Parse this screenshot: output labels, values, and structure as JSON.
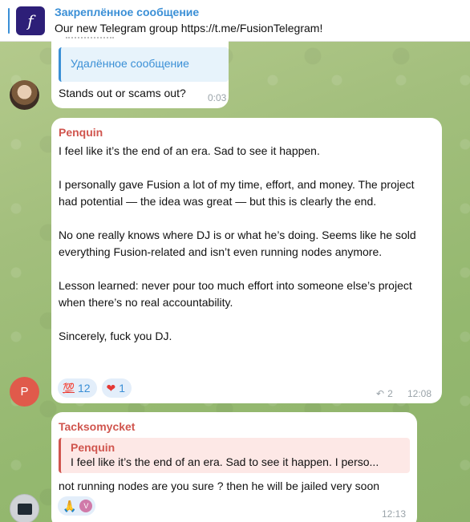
{
  "pinned": {
    "title": "Закреплённое сообщение",
    "text": "Our new Telegram group  https://t.me/FusionTelegram!"
  },
  "message1": {
    "reply_text": "Удалённое сообщение",
    "text": "Stands out or scams out?",
    "time": "0:03"
  },
  "message2": {
    "sender": "Penquin",
    "avatar_letter": "P",
    "paragraphs": [
      "I feel like it’s the end of an era. Sad to see it happen.",
      "I personally gave Fusion a lot of my time, effort, and money. The project had potential — the idea was great — but this is clearly the end.",
      "No one really knows where DJ is or what he’s doing. Seems like he sold everything Fusion-related and isn’t even running nodes anymore.",
      "Lesson learned: never pour too much effort into someone else’s project when there’s no real accountability.",
      "Sincerely, fuck you DJ."
    ],
    "reactions": [
      {
        "emoji": "💯",
        "count": "12"
      },
      {
        "emoji": "❤",
        "count": "1"
      }
    ],
    "replies": "2",
    "time": "12:08"
  },
  "message3": {
    "sender": "Tacksomycket",
    "reply_sender": "Penquin",
    "reply_text": "I feel like it’s the end of an era. Sad to see it happen.  I perso...",
    "text": "not running nodes are you sure ? then he will be jailed very soon",
    "reaction_emoji": "🙏",
    "reaction_user": "V",
    "time": "12:13"
  },
  "colors": {
    "accent": "#3a8fd6",
    "sender": "#d0554e"
  }
}
